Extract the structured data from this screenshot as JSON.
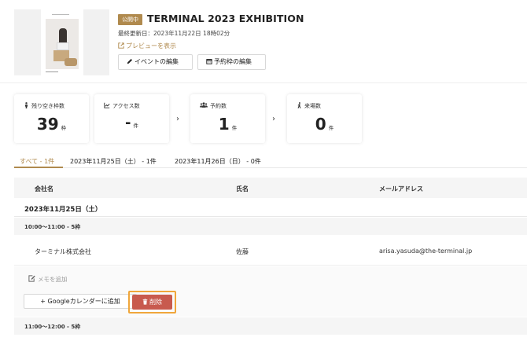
{
  "event": {
    "status_badge": "公開中",
    "title": "TERMINAL 2023 EXHIBITION",
    "updated": "最終更新日：2023年11月22日 18時02分",
    "preview_link": "プレビューを表示",
    "edit_event_button": "イベントの編集",
    "edit_slots_button": "予約枠の編集"
  },
  "stats": [
    {
      "label": "残り空き枠数",
      "value": "39",
      "unit": "枠",
      "icon": "person-icon"
    },
    {
      "label": "アクセス数",
      "value": "-",
      "unit": "件",
      "icon": "line-chart-icon"
    },
    {
      "label": "予約数",
      "value": "1",
      "unit": "件",
      "icon": "users-icon"
    },
    {
      "label": "来場数",
      "value": "0",
      "unit": "件",
      "icon": "walking-icon"
    }
  ],
  "tabs": [
    {
      "label": "すべて - 1件",
      "active": true
    },
    {
      "label": "2023年11月25日（土） - 1件",
      "active": false
    },
    {
      "label": "2023年11月26日（日） - 0件",
      "active": false
    }
  ],
  "table": {
    "columns": [
      "会社名",
      "氏名",
      "メールアドレス"
    ],
    "date_group": "2023年11月25日（土）",
    "slots": [
      {
        "label": "10:00〜11:00 - 5枠"
      },
      {
        "label": "11:00〜12:00 - 5枠"
      }
    ],
    "rows": [
      {
        "company": "ターミナル株式会社",
        "name": "佐藤",
        "email": "arisa.yasuda@the-terminal.jp"
      }
    ],
    "memo_placeholder": "メモを追加",
    "gcal_button": "+ Googleカレンダーに追加",
    "delete_button": "削除"
  },
  "colors": {
    "accent": "#b08a4e",
    "delete": "#c85a4e",
    "highlight": "#f0a63b"
  }
}
